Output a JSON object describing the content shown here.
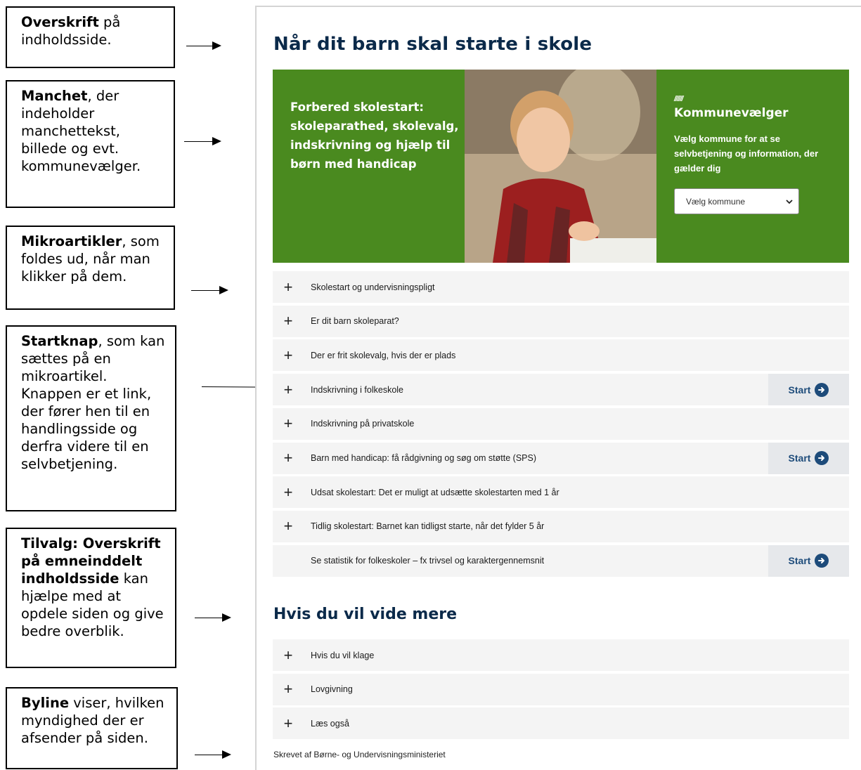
{
  "annotations": [
    {
      "bold": "Overskrift",
      "rest": " på indholdsside."
    },
    {
      "bold": "Manchet",
      "rest": ", der indeholder manchettekst, billede og evt. kommunevælger."
    },
    {
      "bold": "Mikroartikler",
      "rest": ", som foldes ud, når man klikker på dem."
    },
    {
      "bold": "Startknap",
      "rest": ", som kan sættes på en mikroartikel. Knappen er et link, der fører hen til en handlingsside og derfra videre til en selvbetjening."
    },
    {
      "bold": "Tilvalg: Overskrift på emneinddelt indholdsside",
      "rest": " kan hjælpe med at opdele siden og give bedre overblik."
    },
    {
      "bold": "Byline",
      "rest": " viser, hvilken myndighed der er afsender på siden."
    }
  ],
  "page": {
    "title": "Når dit barn skal starte i skole",
    "hero": {
      "text": "Forbered skolestart: skoleparathed, skolevalg, indskrivning og hjælp til børn med handicap",
      "selector_marker": "//////",
      "selector_title": "Kommunevælger",
      "selector_text": "Vælg kommune for at se selvbetjening og information, der gælder dig",
      "select_value": "Vælg kommune"
    },
    "start_label": "Start",
    "articles": [
      {
        "label": "Skolestart og undervisningspligt",
        "plus": true,
        "start": false
      },
      {
        "label": "Er dit barn skoleparat?",
        "plus": true,
        "start": false
      },
      {
        "label": "Der er frit skolevalg, hvis der er plads",
        "plus": true,
        "start": false
      },
      {
        "label": "Indskrivning i folkeskole",
        "plus": true,
        "start": true
      },
      {
        "label": "Indskrivning på privatskole",
        "plus": true,
        "start": false
      },
      {
        "label": "Barn med handicap: få rådgivning og søg om støtte (SPS)",
        "plus": true,
        "start": true
      },
      {
        "label": "Udsat skolestart: Det er muligt at udsætte skolestarten med 1 år",
        "plus": true,
        "start": false
      },
      {
        "label": "Tidlig skolestart: Barnet kan tidligst starte, når det fylder 5 år",
        "plus": true,
        "start": false
      },
      {
        "label": "Se statistik for folkeskoler – fx trivsel og karaktergennemsnit",
        "plus": false,
        "start": true
      }
    ],
    "section_title": "Hvis du vil vide mere",
    "more_articles": [
      {
        "label": "Hvis du vil klage"
      },
      {
        "label": "Lovgivning"
      },
      {
        "label": "Læs også"
      }
    ],
    "byline": "Skrevet af Børne- og Undervisningsministeriet"
  }
}
